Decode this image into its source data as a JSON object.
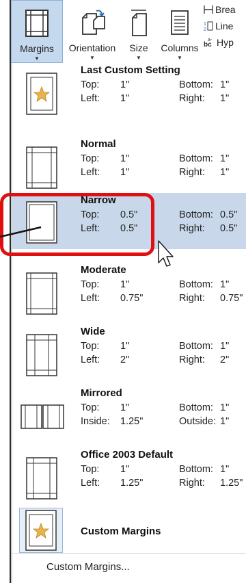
{
  "ribbon": {
    "buttons": [
      {
        "label": "Margins",
        "icon": "margins-icon"
      },
      {
        "label": "Orientation",
        "icon": "orientation-icon"
      },
      {
        "label": "Size",
        "icon": "size-icon"
      },
      {
        "label": "Columns",
        "icon": "columns-icon"
      }
    ],
    "small": [
      "Brea",
      "Line",
      "Hyp"
    ]
  },
  "menu": {
    "items": [
      {
        "title": "Last Custom Setting",
        "labels": [
          "Top:",
          "Left:"
        ],
        "values": [
          "1\"",
          "1\""
        ],
        "labels2": [
          "Bottom:",
          "Right:"
        ],
        "values2": [
          "1\"",
          "1\""
        ],
        "icon": "page-star-icon"
      },
      {
        "title": "Normal",
        "labels": [
          "Top:",
          "Left:"
        ],
        "values": [
          "1\"",
          "1\""
        ],
        "labels2": [
          "Bottom:",
          "Right:"
        ],
        "values2": [
          "1\"",
          "1\""
        ],
        "icon": "page-margins-normal-icon"
      },
      {
        "title": "Narrow",
        "labels": [
          "Top:",
          "Left:"
        ],
        "values": [
          "0.5\"",
          "0.5\""
        ],
        "labels2": [
          "Bottom:",
          "Right:"
        ],
        "values2": [
          "0.5\"",
          "0.5\""
        ],
        "icon": "page-margins-narrow-icon"
      },
      {
        "title": "Moderate",
        "labels": [
          "Top:",
          "Left:"
        ],
        "values": [
          "1\"",
          "0.75\""
        ],
        "labels2": [
          "Bottom:",
          "Right:"
        ],
        "values2": [
          "1\"",
          "0.75\""
        ],
        "icon": "page-margins-moderate-icon"
      },
      {
        "title": "Wide",
        "labels": [
          "Top:",
          "Left:"
        ],
        "values": [
          "1\"",
          "2\""
        ],
        "labels2": [
          "Bottom:",
          "Right:"
        ],
        "values2": [
          "1\"",
          "2\""
        ],
        "icon": "page-margins-wide-icon"
      },
      {
        "title": "Mirrored",
        "labels": [
          "Top:",
          "Inside:"
        ],
        "values": [
          "1\"",
          "1.25\""
        ],
        "labels2": [
          "Bottom:",
          "Outside:"
        ],
        "values2": [
          "1\"",
          "1\""
        ],
        "icon": "page-margins-mirrored-icon"
      },
      {
        "title": "Office 2003 Default",
        "labels": [
          "Top:",
          "Left:"
        ],
        "values": [
          "1\"",
          "1.25\""
        ],
        "labels2": [
          "Bottom:",
          "Right:"
        ],
        "values2": [
          "1\"",
          "1.25\""
        ],
        "icon": "page-margins-office2003-icon"
      },
      {
        "title": "Custom Margins",
        "icon": "page-star-icon"
      }
    ],
    "footer": "Custom Margins..."
  },
  "colors": {
    "highlight": "#c8d8ea",
    "annotation": "#e01010",
    "star": "#e8b44a"
  }
}
